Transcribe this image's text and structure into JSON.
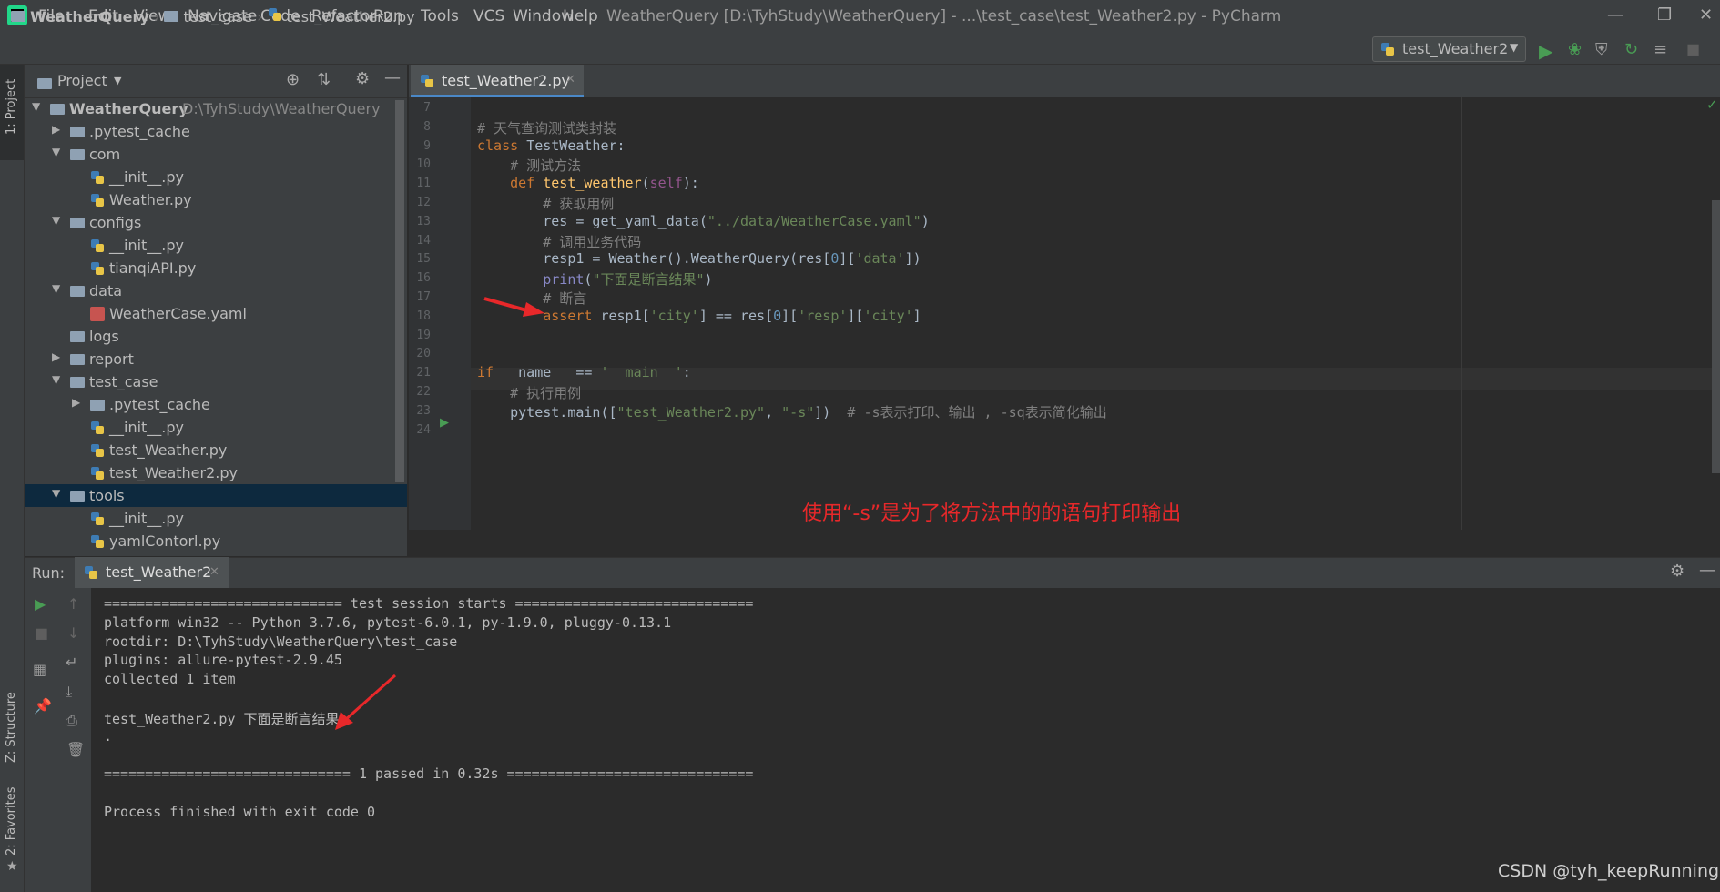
{
  "menu": [
    "File",
    "Edit",
    "View",
    "Navigate",
    "Code",
    "Refactor",
    "Run",
    "Tools",
    "VCS",
    "Window",
    "Help"
  ],
  "window_title": "WeatherQuery [D:\\TyhStudy\\WeatherQuery] - ...\\test_case\\test_Weather2.py - PyCharm",
  "breadcrumbs": [
    "WeatherQuery",
    "test_case",
    "test_Weather2.py"
  ],
  "run_config": "test_Weather2",
  "side_tabs": {
    "project": "1: Project",
    "structure": "Z: Structure",
    "favorites": "2: Favorites"
  },
  "project": {
    "title": "Project",
    "tree": [
      {
        "label": "WeatherQuery",
        "path": "D:\\TyhStudy\\WeatherQuery",
        "type": "folder",
        "depth": 0,
        "expanded": true
      },
      {
        "label": ".pytest_cache",
        "type": "folder",
        "depth": 1,
        "expanded": false
      },
      {
        "label": "com",
        "type": "folder",
        "depth": 1,
        "expanded": true
      },
      {
        "label": "__init__.py",
        "type": "py",
        "depth": 2
      },
      {
        "label": "Weather.py",
        "type": "py",
        "depth": 2
      },
      {
        "label": "configs",
        "type": "folder",
        "depth": 1,
        "expanded": true
      },
      {
        "label": "__init__.py",
        "type": "py",
        "depth": 2
      },
      {
        "label": "tianqiAPI.py",
        "type": "py",
        "depth": 2
      },
      {
        "label": "data",
        "type": "folder",
        "depth": 1,
        "expanded": true
      },
      {
        "label": "WeatherCase.yaml",
        "type": "yaml",
        "depth": 2
      },
      {
        "label": "logs",
        "type": "folder",
        "depth": 1
      },
      {
        "label": "report",
        "type": "folder",
        "depth": 1,
        "expanded": false
      },
      {
        "label": "test_case",
        "type": "folder",
        "depth": 1,
        "expanded": true
      },
      {
        "label": ".pytest_cache",
        "type": "folder",
        "depth": 2,
        "expanded": false
      },
      {
        "label": "__init__.py",
        "type": "py",
        "depth": 2
      },
      {
        "label": "test_Weather.py",
        "type": "py",
        "depth": 2
      },
      {
        "label": "test_Weather2.py",
        "type": "py",
        "depth": 2
      },
      {
        "label": "tools",
        "type": "folder",
        "depth": 1,
        "expanded": true,
        "selected": true
      },
      {
        "label": "__init__.py",
        "type": "py",
        "depth": 2
      },
      {
        "label": "yamlContorl.py",
        "type": "py",
        "depth": 2
      }
    ]
  },
  "editor": {
    "tab": "test_Weather2.py",
    "line_numbers": [
      "7",
      "8",
      "9",
      "10",
      "11",
      "12",
      "13",
      "14",
      "15",
      "16",
      "17",
      "18",
      "19",
      "20",
      "21",
      "22",
      "23",
      "24"
    ],
    "lines": [
      [],
      [
        [
          "cm",
          "# 天气查询测试类封装"
        ]
      ],
      [
        [
          "kw",
          "class "
        ],
        [
          "tx",
          "TestWeather:"
        ]
      ],
      [
        [
          "tx",
          "    "
        ],
        [
          "cm",
          "# 测试方法"
        ]
      ],
      [
        [
          "tx",
          "    "
        ],
        [
          "kw",
          "def "
        ],
        [
          "fn",
          "test_weather"
        ],
        [
          "tx",
          "("
        ],
        [
          "sf",
          "self"
        ],
        [
          "tx",
          "):"
        ]
      ],
      [
        [
          "tx",
          "        "
        ],
        [
          "cm",
          "# 获取用例"
        ]
      ],
      [
        [
          "tx",
          "        res = get_yaml_data("
        ],
        [
          "st",
          "\"../data/WeatherCase.yaml\""
        ],
        [
          "tx",
          ")"
        ]
      ],
      [
        [
          "tx",
          "        "
        ],
        [
          "cm",
          "# 调用业务代码"
        ]
      ],
      [
        [
          "tx",
          "        resp1 = Weather().WeatherQuery(res["
        ],
        [
          "nm",
          "0"
        ],
        [
          "tx",
          "]["
        ],
        [
          "st",
          "'data'"
        ],
        [
          "tx",
          "])"
        ]
      ],
      [
        [
          "tx",
          "        "
        ],
        [
          "bi",
          "print"
        ],
        [
          "tx",
          "("
        ],
        [
          "st",
          "\"下面是断言结果\""
        ],
        [
          "tx",
          ")"
        ]
      ],
      [
        [
          "tx",
          "        "
        ],
        [
          "cm",
          "# 断言"
        ]
      ],
      [
        [
          "tx",
          "        "
        ],
        [
          "kw",
          "assert "
        ],
        [
          "tx",
          "resp1["
        ],
        [
          "st",
          "'city'"
        ],
        [
          "tx",
          "] == res["
        ],
        [
          "nm",
          "0"
        ],
        [
          "tx",
          "]["
        ],
        [
          "st",
          "'resp'"
        ],
        [
          "tx",
          "]["
        ],
        [
          "st",
          "'city'"
        ],
        [
          "tx",
          "]"
        ]
      ],
      [],
      [],
      [
        [
          "kw",
          "if "
        ],
        [
          "tx",
          "__name__ == "
        ],
        [
          "st",
          "'__main__'"
        ],
        [
          "tx",
          ":"
        ]
      ],
      [
        [
          "tx",
          "    "
        ],
        [
          "cm",
          "# 执行用例"
        ]
      ],
      [
        [
          "tx",
          "    pytest.main(["
        ],
        [
          "st",
          "\"test_Weather2.py\""
        ],
        [
          "tx",
          ", "
        ],
        [
          "st",
          "\"-s\""
        ],
        [
          "tx",
          "])  "
        ],
        [
          "cm",
          "# -s表示打印、输出 , -sq表示简化输出"
        ]
      ],
      []
    ]
  },
  "annotation_text": "使用“-s”是为了将方法中的的语句打印输出",
  "run": {
    "label": "Run:",
    "tab": "test_Weather2",
    "console": [
      "============================= test session starts =============================",
      "platform win32 -- Python 3.7.6, pytest-6.0.1, py-1.9.0, pluggy-0.13.1",
      "rootdir: D:\\TyhStudy\\WeatherQuery\\test_case",
      "plugins: allure-pytest-2.9.45",
      "collected 1 item",
      "",
      "test_Weather2.py 下面是断言结果",
      ".",
      "",
      "============================== 1 passed in 0.32s ==============================",
      "",
      "Process finished with exit code 0"
    ]
  },
  "watermark": "CSDN @tyh_keepRunning",
  "colors": {
    "accent": "#4a88c7",
    "annotation": "#e8282a",
    "run_green": "#499c54"
  }
}
